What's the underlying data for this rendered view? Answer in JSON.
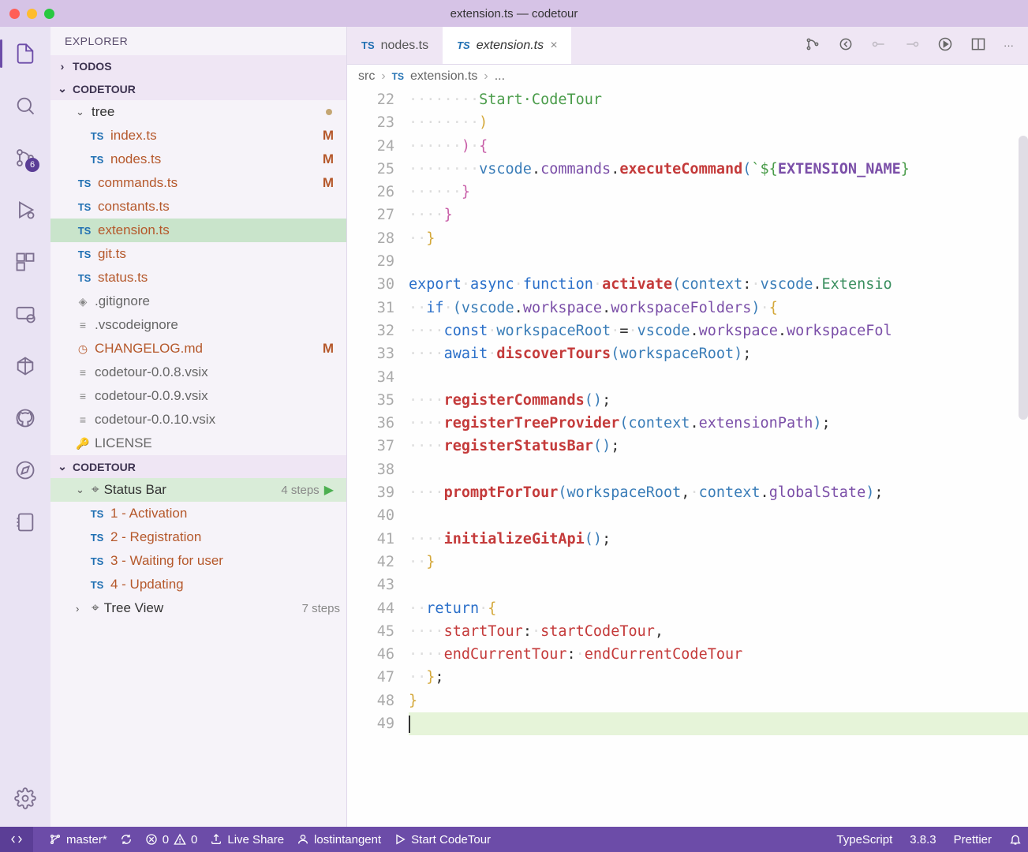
{
  "titlebar": {
    "title": "extension.ts — codetour"
  },
  "sidebar": {
    "header": "EXPLORER",
    "sections": {
      "todos": {
        "label": "TODOS",
        "expanded": false
      },
      "project": {
        "label": "CODETOUR",
        "expanded": true,
        "tree": {
          "folder": {
            "name": "tree",
            "modified": true
          },
          "files_in_folder": [
            {
              "icon": "TS",
              "name": "index.ts",
              "badge": "M"
            },
            {
              "icon": "TS",
              "name": "nodes.ts",
              "badge": "M"
            }
          ],
          "files": [
            {
              "icon": "TS",
              "name": "commands.ts",
              "badge": "M"
            },
            {
              "icon": "TS",
              "name": "constants.ts"
            },
            {
              "icon": "TS",
              "name": "extension.ts",
              "selected": true
            },
            {
              "icon": "TS",
              "name": "git.ts"
            },
            {
              "icon": "TS",
              "name": "status.ts"
            },
            {
              "icon": "git",
              "name": ".gitignore"
            },
            {
              "icon": "file",
              "name": ".vscodeignore"
            },
            {
              "icon": "clock",
              "name": "CHANGELOG.md",
              "badge": "M"
            },
            {
              "icon": "file",
              "name": "codetour-0.0.8.vsix"
            },
            {
              "icon": "file",
              "name": "codetour-0.0.9.vsix"
            },
            {
              "icon": "file",
              "name": "codetour-0.0.10.vsix"
            },
            {
              "icon": "key",
              "name": "LICENSE"
            }
          ]
        }
      },
      "codetour": {
        "label": "CODETOUR",
        "expanded": true,
        "tours": [
          {
            "name": "Status Bar",
            "steps_label": "4 steps",
            "active": true,
            "steps": [
              {
                "icon": "TS",
                "name": "1 - Activation"
              },
              {
                "icon": "TS",
                "name": "2 - Registration"
              },
              {
                "icon": "TS",
                "name": "3 - Waiting for user"
              },
              {
                "icon": "TS",
                "name": "4 - Updating"
              }
            ]
          },
          {
            "name": "Tree View",
            "steps_label": "7 steps",
            "active": false
          }
        ]
      }
    }
  },
  "activitybar": {
    "scm_badge": "6"
  },
  "tabs": [
    {
      "icon": "TS",
      "label": "nodes.ts",
      "active": false
    },
    {
      "icon": "TS",
      "label": "extension.ts",
      "active": true
    }
  ],
  "breadcrumb": {
    "parts": [
      "src",
      "extension.ts"
    ],
    "file_icon": "TS",
    "tail": "..."
  },
  "editor": {
    "first_line": 22,
    "lines": [
      {
        "n": 22,
        "tokens": [
          [
            "ws",
            "········"
          ],
          [
            "str",
            "Start·CodeTour"
          ]
        ]
      },
      {
        "n": 23,
        "tokens": [
          [
            "ws",
            "········"
          ],
          [
            "brace1",
            ")"
          ]
        ]
      },
      {
        "n": 24,
        "tokens": [
          [
            "ws",
            "······"
          ],
          [
            "brace2",
            ")"
          ],
          [
            "ws",
            "·"
          ],
          [
            "brace2",
            "{"
          ]
        ]
      },
      {
        "n": 25,
        "tokens": [
          [
            "ws",
            "········"
          ],
          [
            "var",
            "vscode"
          ],
          [
            "op",
            "."
          ],
          [
            "prop",
            "commands"
          ],
          [
            "op",
            "."
          ],
          [
            "fn",
            "executeCommand"
          ],
          [
            "paren",
            "("
          ],
          [
            "str",
            "`${"
          ],
          [
            "const",
            "EXTENSION_NAME"
          ],
          [
            "str",
            "}"
          ]
        ]
      },
      {
        "n": 26,
        "tokens": [
          [
            "ws",
            "······"
          ],
          [
            "brace2",
            "}"
          ]
        ]
      },
      {
        "n": 27,
        "tokens": [
          [
            "ws",
            "····"
          ],
          [
            "brace2",
            "}"
          ]
        ]
      },
      {
        "n": 28,
        "tokens": [
          [
            "ws",
            "··"
          ],
          [
            "brace1",
            "}"
          ]
        ]
      },
      {
        "n": 29,
        "tokens": []
      },
      {
        "n": 30,
        "tokens": [
          [
            "kw",
            "export"
          ],
          [
            "ws",
            "·"
          ],
          [
            "kw",
            "async"
          ],
          [
            "ws",
            "·"
          ],
          [
            "kw",
            "function"
          ],
          [
            "ws",
            "·"
          ],
          [
            "fn",
            "activate"
          ],
          [
            "paren",
            "("
          ],
          [
            "var",
            "context"
          ],
          [
            "op",
            ":"
          ],
          [
            "ws",
            "·"
          ],
          [
            "var",
            "vscode"
          ],
          [
            "op",
            "."
          ],
          [
            "type",
            "Extensio"
          ]
        ]
      },
      {
        "n": 31,
        "tokens": [
          [
            "ws",
            "··"
          ],
          [
            "kw",
            "if"
          ],
          [
            "ws",
            "·"
          ],
          [
            "paren",
            "("
          ],
          [
            "var",
            "vscode"
          ],
          [
            "op",
            "."
          ],
          [
            "prop",
            "workspace"
          ],
          [
            "op",
            "."
          ],
          [
            "prop",
            "workspaceFolders"
          ],
          [
            "paren",
            ")"
          ],
          [
            "ws",
            "·"
          ],
          [
            "brace1",
            "{"
          ]
        ]
      },
      {
        "n": 32,
        "tokens": [
          [
            "ws",
            "····"
          ],
          [
            "kw",
            "const"
          ],
          [
            "ws",
            "·"
          ],
          [
            "var",
            "workspaceRoot"
          ],
          [
            "ws",
            "·"
          ],
          [
            "op",
            "="
          ],
          [
            "ws",
            "·"
          ],
          [
            "var",
            "vscode"
          ],
          [
            "op",
            "."
          ],
          [
            "prop",
            "workspace"
          ],
          [
            "op",
            "."
          ],
          [
            "prop",
            "workspaceFol"
          ]
        ]
      },
      {
        "n": 33,
        "tokens": [
          [
            "ws",
            "····"
          ],
          [
            "kw",
            "await"
          ],
          [
            "ws",
            "·"
          ],
          [
            "fn",
            "discoverTours"
          ],
          [
            "paren",
            "("
          ],
          [
            "var",
            "workspaceRoot"
          ],
          [
            "paren",
            ")"
          ],
          [
            "op",
            ";"
          ]
        ]
      },
      {
        "n": 34,
        "tokens": []
      },
      {
        "n": 35,
        "tokens": [
          [
            "ws",
            "····"
          ],
          [
            "fn",
            "registerCommands"
          ],
          [
            "paren",
            "("
          ],
          [
            "paren",
            ")"
          ],
          [
            "op",
            ";"
          ]
        ]
      },
      {
        "n": 36,
        "tokens": [
          [
            "ws",
            "····"
          ],
          [
            "fn",
            "registerTreeProvider"
          ],
          [
            "paren",
            "("
          ],
          [
            "var",
            "context"
          ],
          [
            "op",
            "."
          ],
          [
            "prop",
            "extensionPath"
          ],
          [
            "paren",
            ")"
          ],
          [
            "op",
            ";"
          ]
        ]
      },
      {
        "n": 37,
        "tokens": [
          [
            "ws",
            "····"
          ],
          [
            "fn",
            "registerStatusBar"
          ],
          [
            "paren",
            "("
          ],
          [
            "paren",
            ")"
          ],
          [
            "op",
            ";"
          ]
        ]
      },
      {
        "n": 38,
        "tokens": []
      },
      {
        "n": 39,
        "tokens": [
          [
            "ws",
            "····"
          ],
          [
            "fn",
            "promptForTour"
          ],
          [
            "paren",
            "("
          ],
          [
            "var",
            "workspaceRoot"
          ],
          [
            "op",
            ","
          ],
          [
            "ws",
            "·"
          ],
          [
            "var",
            "context"
          ],
          [
            "op",
            "."
          ],
          [
            "prop",
            "globalState"
          ],
          [
            "paren",
            ")"
          ],
          [
            "op",
            ";"
          ]
        ]
      },
      {
        "n": 40,
        "tokens": []
      },
      {
        "n": 41,
        "tokens": [
          [
            "ws",
            "····"
          ],
          [
            "fn",
            "initializeGitApi"
          ],
          [
            "paren",
            "("
          ],
          [
            "paren",
            ")"
          ],
          [
            "op",
            ";"
          ]
        ]
      },
      {
        "n": 42,
        "tokens": [
          [
            "ws",
            "··"
          ],
          [
            "brace1",
            "}"
          ]
        ]
      },
      {
        "n": 43,
        "tokens": []
      },
      {
        "n": 44,
        "tokens": [
          [
            "ws",
            "··"
          ],
          [
            "kw",
            "return"
          ],
          [
            "ws",
            "·"
          ],
          [
            "brace1",
            "{"
          ]
        ]
      },
      {
        "n": 45,
        "tokens": [
          [
            "ws",
            "····"
          ],
          [
            "fnr",
            "startTour"
          ],
          [
            "op",
            ":"
          ],
          [
            "ws",
            "·"
          ],
          [
            "fnr",
            "startCodeTour"
          ],
          [
            "op",
            ","
          ]
        ]
      },
      {
        "n": 46,
        "tokens": [
          [
            "ws",
            "····"
          ],
          [
            "fnr",
            "endCurrentTour"
          ],
          [
            "op",
            ":"
          ],
          [
            "ws",
            "·"
          ],
          [
            "fnr",
            "endCurrentCodeTour"
          ]
        ]
      },
      {
        "n": 47,
        "tokens": [
          [
            "ws",
            "··"
          ],
          [
            "brace1",
            "}"
          ],
          [
            "op",
            ";"
          ]
        ]
      },
      {
        "n": 48,
        "tokens": [
          [
            "brace1",
            "}"
          ]
        ]
      },
      {
        "n": 49,
        "tokens": [],
        "highlight": true,
        "cursor": true
      }
    ]
  },
  "statusbar": {
    "branch": "master*",
    "sync": "",
    "errors": "0",
    "warnings": "0",
    "liveshare": "Live Share",
    "account": "lostintangent",
    "codetour": "Start CodeTour",
    "language": "TypeScript",
    "ts_version": "3.8.3",
    "prettier": "Prettier"
  }
}
